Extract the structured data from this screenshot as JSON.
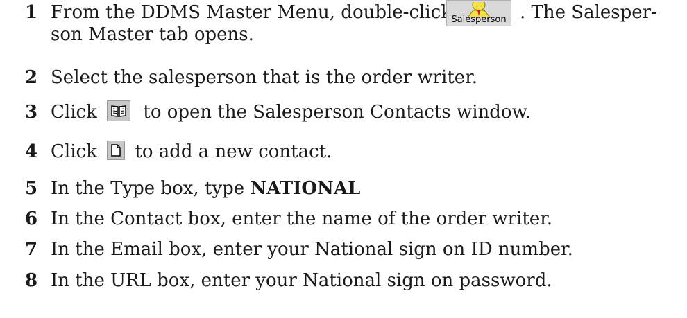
{
  "steps": [
    {
      "num": "1",
      "before": "From the DDMS Master Menu, double-click",
      "after": ". The Salesper-",
      "line2": "son Master tab opens.",
      "icon_label": "Salesperson",
      "icon": "salesperson-icon"
    },
    {
      "num": "2",
      "text": "Select the salesperson that is the order writer."
    },
    {
      "num": "3",
      "before": "Click",
      "after": "to open the Salesperson Contacts window.",
      "icon": "contacts-book-icon"
    },
    {
      "num": "4",
      "before": "Click",
      "after": "to add a new contact.",
      "icon": "new-document-icon"
    },
    {
      "num": "5",
      "before": "In the Type box, type",
      "bold": "NATIONAL"
    },
    {
      "num": "6",
      "text": "In the Contact box, enter the name of the order writer."
    },
    {
      "num": "7",
      "text": "In the Email box, enter your National sign on ID number."
    },
    {
      "num": "8",
      "text": "In the URL box, enter your National sign on password."
    }
  ]
}
